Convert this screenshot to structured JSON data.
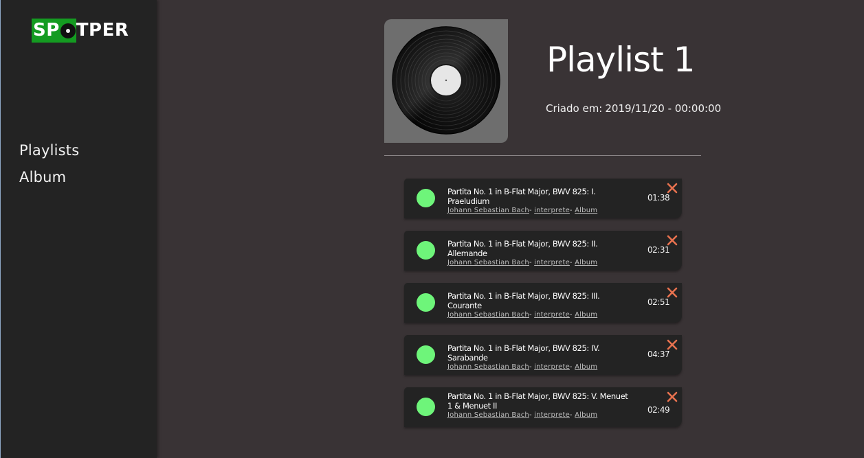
{
  "app": {
    "logo_text_left": "SP",
    "logo_text_right": "TPER",
    "brand_color": "#149b21"
  },
  "sidebar": {
    "items": [
      {
        "label": "Playlists"
      },
      {
        "label": "Album"
      }
    ]
  },
  "playlist": {
    "title": "Playlist 1",
    "created_label": "Criado em:",
    "created_value": "2019/11/20 - 00:00:00",
    "cover_icon": "vinyl-record-icon"
  },
  "tracks": [
    {
      "name": "Partita No. 1 in B-Flat Major, BWV 825: I. Praeludium",
      "composer": "Johann Sebastian Bach",
      "performer": "interprete",
      "album": "Album",
      "duration": "01:38"
    },
    {
      "name": "Partita No. 1 in B-Flat Major, BWV 825: II. Allemande",
      "composer": "Johann Sebastian Bach",
      "performer": "interprete",
      "album": "Album",
      "duration": "02:31"
    },
    {
      "name": "Partita No. 1 in B-Flat Major, BWV 825: III. Courante",
      "composer": "Johann Sebastian Bach",
      "performer": "interprete",
      "album": "Album",
      "duration": "02:51"
    },
    {
      "name": "Partita No. 1 in B-Flat Major, BWV 825: IV. Sarabande",
      "composer": "Johann Sebastian Bach",
      "performer": "interprete",
      "album": "Album",
      "duration": "04:37"
    },
    {
      "name": "Partita No. 1 in B-Flat Major, BWV 825: V. Menuet 1 & Menuet II",
      "composer": "Johann Sebastian Bach",
      "performer": "interprete",
      "album": "Album",
      "duration": "02:49"
    }
  ],
  "separator": "-",
  "colors": {
    "play_button": "#6ef57a",
    "remove_icon": "#e8724f",
    "background": "#393335",
    "sidebar": "#232323",
    "card": "#232323"
  }
}
